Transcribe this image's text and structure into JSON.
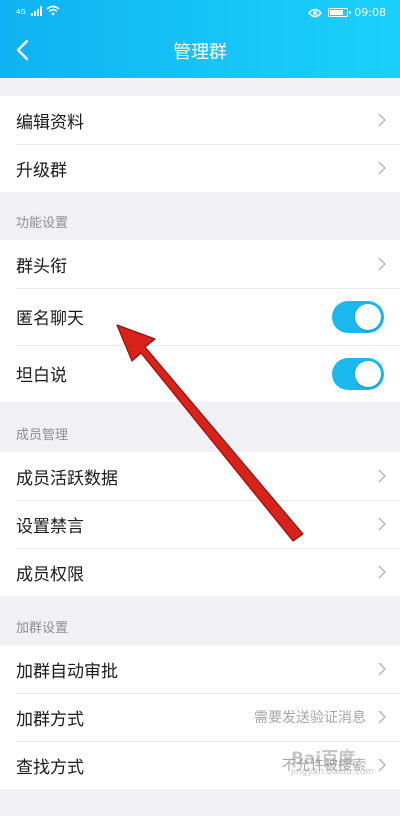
{
  "status_bar": {
    "network": "4G",
    "time": "09:08"
  },
  "header": {
    "title": "管理群"
  },
  "top_items": [
    {
      "label": "编辑资料"
    },
    {
      "label": "升级群"
    }
  ],
  "sections": {
    "functions": {
      "label": "功能设置",
      "items": [
        {
          "label": "群头衔"
        },
        {
          "label": "匿名聊天",
          "toggle_on": true
        },
        {
          "label": "坦白说",
          "toggle_on": true
        }
      ]
    },
    "members": {
      "label": "成员管理",
      "items": [
        {
          "label": "成员活跃数据"
        },
        {
          "label": "设置禁言"
        },
        {
          "label": "成员权限"
        }
      ]
    },
    "join": {
      "label": "加群设置",
      "items": [
        {
          "label": "加群自动审批"
        },
        {
          "label": "加群方式",
          "value": "需要发送验证消息"
        },
        {
          "label": "查找方式",
          "value": "不允许被搜索"
        }
      ]
    }
  },
  "watermark": {
    "text": "Bai百度",
    "sub": "jingyan.baidu.com"
  },
  "colors": {
    "header": "#17c6f8",
    "toggle": "#1bb8f0",
    "annotation_arrow": "#d9221c"
  },
  "icons": [
    "back-icon",
    "chevron-right-icon",
    "signal-icon",
    "wifi-icon",
    "eye-icon",
    "battery-icon"
  ]
}
